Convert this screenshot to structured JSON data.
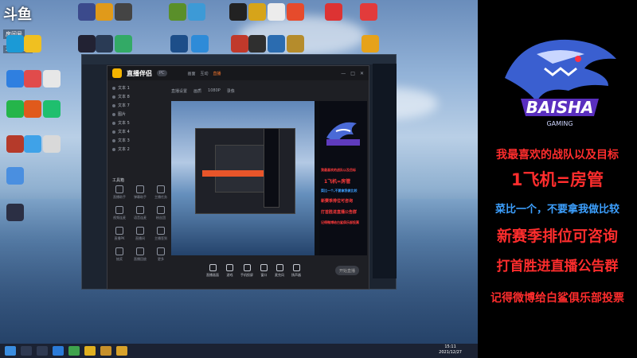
{
  "desktop": {
    "watermark": {
      "logo": "斗鱼",
      "room": "房间号",
      "number": "2041533"
    },
    "icons": [
      {
        "label": "",
        "color": "#d33"
      },
      {
        "label": "",
        "color": "#3a7"
      },
      {
        "label": "",
        "color": "#29c"
      },
      {
        "label": "",
        "color": "#e53"
      },
      {
        "label": "",
        "color": "#36c"
      },
      {
        "label": "",
        "color": "#7b3"
      }
    ]
  },
  "stream_app": {
    "name": "直播伴侣",
    "badge": "PC",
    "top_tabs": [
      "画面",
      "互动",
      "直播"
    ],
    "active_tab": "直播",
    "preview_toolbar": [
      "直播设置",
      "画质",
      "1080P",
      "录像"
    ],
    "scenes": [
      "文本 1",
      "文本 8",
      "文本 7",
      "图片",
      "文本 5",
      "文本 4",
      "文本 3",
      "文本 2"
    ],
    "tools_header": "工具箱",
    "tools": [
      "直播助手",
      "弹幕助手",
      "主播任务",
      "视频连麦",
      "语音连麦",
      "粉丝团",
      "直播PK",
      "直播间",
      "主播签到",
      "抽奖",
      "直播回放",
      "更多"
    ],
    "bottom_buttons": [
      "直播画面",
      "游戏",
      "手机投屏",
      "窗口",
      "麦克风",
      "扬声器"
    ],
    "go_live": "开始直播"
  },
  "preview_side_text": [
    "我最喜欢的战队以及目标",
    "1飞机=房管",
    "菜比一个,不要拿我做比较",
    "新赛季排位可咨询",
    "打首胜进直播公告群",
    "记得微博给白鲨俱乐部投票"
  ],
  "overlay": {
    "logo_text": "BAISHA",
    "logo_sub": "GAMING",
    "lines": [
      {
        "text": "我最喜欢的战队以及目标",
        "color": "#ff2d2d"
      },
      {
        "text": "1飞机=房管",
        "color": "#ff2d2d"
      },
      {
        "text": "菜比一个，不要拿我做比较",
        "color": "#3da0ff"
      },
      {
        "text": "新赛季排位可咨询",
        "color": "#ff2d2d"
      },
      {
        "text": "打首胜进直播公告群",
        "color": "#ff2d2d"
      },
      {
        "text": "记得微博给白鲨俱乐部投票",
        "color": "#ff2d2d"
      }
    ]
  },
  "taskbar": {
    "time": "15:11",
    "date": "2021/12/27"
  }
}
